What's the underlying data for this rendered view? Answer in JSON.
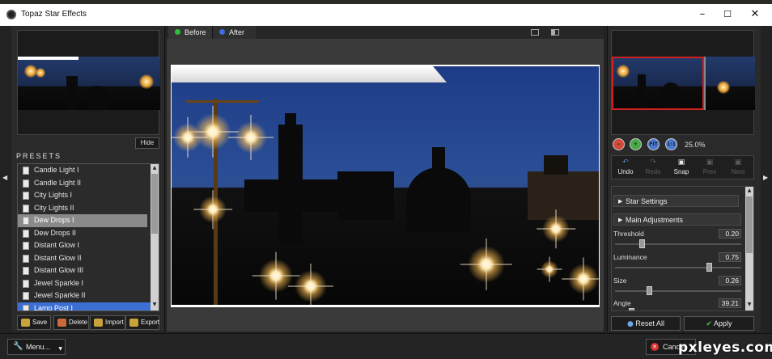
{
  "window": {
    "title": "Topaz Star Effects"
  },
  "tabs": [
    {
      "label": "Before",
      "color": "#2fbf3a"
    },
    {
      "label": "After",
      "color": "#3a6fe0"
    }
  ],
  "left": {
    "hide_label": "Hide",
    "presets_label": "PRESETS",
    "presets": [
      "Candle Light I",
      "Candle Light II",
      "City Lights I",
      "City Lights II",
      "Dew Drops I",
      "Dew Drops II",
      "Distant Glow I",
      "Distant Glow II",
      "Distant Glow III",
      "Jewel Sparkle I",
      "Jewel Sparkle II",
      "Lamp Post I"
    ],
    "selected_preset": "Dew Drops I",
    "highlighted_preset": "Lamp Post I",
    "buttons": {
      "save": "Save",
      "delete": "Delete",
      "import": "Import",
      "export": "Export"
    }
  },
  "right": {
    "zoom_level": "25.0%",
    "history": {
      "undo": "Undo",
      "redo": "Redo",
      "snap": "Snap",
      "prev": "Prev",
      "next": "Next"
    },
    "sections": {
      "star_settings": "Star Settings",
      "main_adjustments": "Main Adjustments"
    },
    "params": [
      {
        "label": "Threshold",
        "value": "0.20",
        "fraction": 0.2
      },
      {
        "label": "Luminance",
        "value": "0.75",
        "fraction": 0.75
      },
      {
        "label": "Size",
        "value": "0.26",
        "fraction": 0.26
      },
      {
        "label": "Angle",
        "value": "39.21",
        "fraction": 0.11
      }
    ],
    "reset_label": "Reset All",
    "apply_label": "Apply"
  },
  "bottom": {
    "menu_label": "Menu...",
    "cancel_label": "Cancel"
  },
  "watermark": "pxleyes.com",
  "colors": {
    "accent_select": "#3b6fd1",
    "preview_frame": "#d12020"
  }
}
